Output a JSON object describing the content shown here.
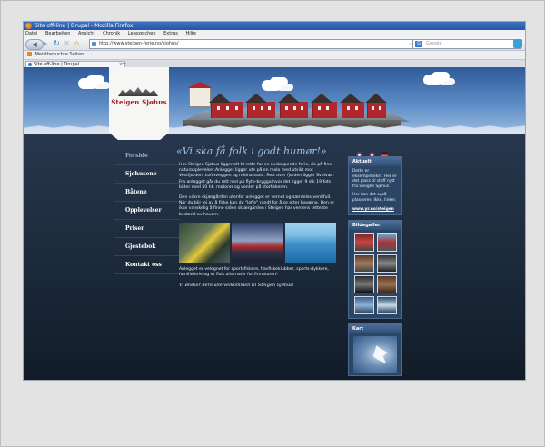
{
  "browser": {
    "title": "Site off-line | Drupal - Mozilla Firefox",
    "menu": [
      "Datei",
      "Bearbeiten",
      "Ansicht",
      "Chronik",
      "Lesezeichen",
      "Extras",
      "Hilfe"
    ],
    "url": "http://www.steigen-ferie.no/sjohus/",
    "search_placeholder": "Google",
    "bookmark": "Meistbesuchte Seiten",
    "tab": "Site off-line | Drupal"
  },
  "site": {
    "logo_text": "Steigen Sjøhus",
    "nav": [
      "Forside",
      "Sjøhusene",
      "Båtene",
      "Opplevelser",
      "Priser",
      "Gjestebok",
      "Kontakt oss"
    ],
    "slogan": "«Vi ska få folk i godt humør!»",
    "para1": "Hos Steigen Sjøhus ligger alt til rette for en avslappende ferie, rik på fine naturopplevelser.Anlegget ligger ute på en molo med utsikt mot Vestfjorden, Lofotveggen og midnattsola. Rett over fjorden ligger Svolvær. Fra anlegget går du rett ned på flyte-brygga hvor det ligger 9 stk 19 fots båter med 50 hk. motorer og venter på storfiskeren.",
    "para2": "Den vakre skjærgården utenfor anlegget er vernet og særdeles verdifull. Når du blir lei av å fiske kan du \"loffe\" rundt for å se etter havørna. Den er ikke vanskelig å finne siden skjærgården i Steigen har verdens tetteste bestand av havørn.",
    "para3": "Anlegget er velegnet for sportsfiskere, havfiskeklubber, sports-dykkere, familieferie og et flott alternativ for firmaturen!",
    "closing": "Vi ønsker dere alle velkommen til Steigen Sjøhus!",
    "aktuelt_title": "Aktuelt",
    "aktuelt_text": "Dette er eksempeltekst. Her er det plass til stoff nytt fra Steigen Sjøhus.",
    "aktuelt_text2": "Her kan det også plasseres. Ikke, linker.",
    "aktuelt_link": "www.yr.no/steigen",
    "gallery_title": "Bildegalleri",
    "map_title": "Kart"
  },
  "colors": {
    "page_bg": "#27364c",
    "accent": "#9fc2e6",
    "logo_red": "#a3161a"
  }
}
